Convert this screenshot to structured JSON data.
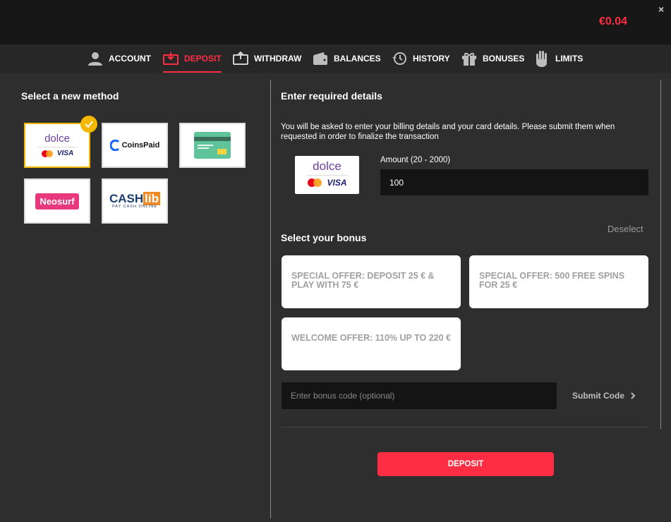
{
  "header": {
    "balance": "€0.04",
    "close_symbol": "×"
  },
  "nav": {
    "tabs": [
      {
        "label": "ACCOUNT",
        "icon": "user-icon"
      },
      {
        "label": "DEPOSIT",
        "icon": "deposit-icon",
        "active": true
      },
      {
        "label": "WITHDRAW",
        "icon": "withdraw-icon"
      },
      {
        "label": "BALANCES",
        "icon": "wallet-icon"
      },
      {
        "label": "HISTORY",
        "icon": "history-icon"
      },
      {
        "label": "BONUSES",
        "icon": "gift-icon"
      },
      {
        "label": "LIMITS",
        "icon": "hand-icon"
      }
    ]
  },
  "methods": {
    "title": "Select a new method",
    "items": [
      {
        "brand": "dolce",
        "sub": "VISA",
        "selected": true
      },
      {
        "brand": "CoinsPaid"
      },
      {
        "brand": "card",
        "icon": "credit-card-icon"
      },
      {
        "brand": "Neosurf"
      },
      {
        "brand": "CASH",
        "brand2": "lib",
        "sub": "PAY CASH ONLINE"
      }
    ]
  },
  "details": {
    "title": "Enter required details",
    "info": "You will be asked to enter your billing details and your card details. Please submit them when requested in order to finalize the transaction",
    "logo_brand": "dolce",
    "logo_sub": "VISA",
    "amount_label": "Amount (20 - 2000)",
    "amount_value": "100"
  },
  "bonus": {
    "deselect": "Deselect",
    "title": "Select your bonus",
    "offers": [
      "SPECIAL OFFER: DEPOSIT 25 € & PLAY WITH 75 €",
      "SPECIAL OFFER: 500 FREE SPINS FOR 25 €",
      "WELCOME OFFER: 110% UP TO 220 €"
    ],
    "code_placeholder": "Enter bonus code (optional)",
    "submit_label": "Submit Code"
  },
  "actions": {
    "deposit_label": "DEPOSIT"
  },
  "colors": {
    "accent": "#ff2d43",
    "selected": "#f5b800",
    "bg": "#2e2e2e"
  }
}
